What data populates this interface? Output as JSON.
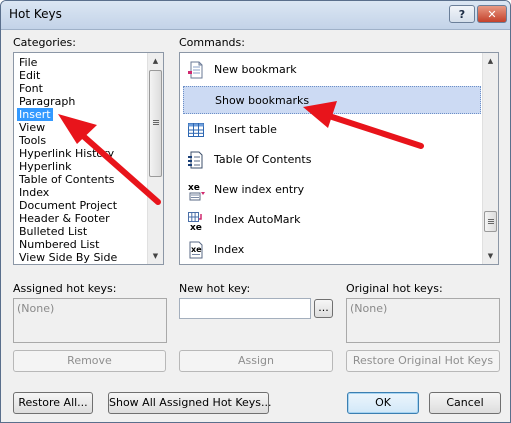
{
  "window": {
    "title": "Hot Keys"
  },
  "titlebar": {
    "help_label": "?",
    "close_label": "✕"
  },
  "categories": {
    "label": "Categories:",
    "items": [
      "File",
      "Edit",
      "Font",
      "Paragraph",
      "Insert",
      "View",
      "Tools",
      "Hyperlink History",
      "Hyperlink",
      "Table of Contents",
      "Index",
      "Document Project",
      "Header & Footer",
      "Bulleted List",
      "Numbered List",
      "View Side By Side"
    ],
    "selected": "Insert"
  },
  "commands": {
    "label": "Commands:",
    "items": [
      {
        "label": "New bookmark",
        "icon": "new-bookmark-icon"
      },
      {
        "label": "Show bookmarks",
        "icon": "",
        "selected": true
      },
      {
        "label": "Insert table",
        "icon": "insert-table-icon"
      },
      {
        "label": "Table Of Contents",
        "icon": "table-of-contents-icon"
      },
      {
        "label": "New index entry",
        "icon": "new-index-entry-icon"
      },
      {
        "label": "Index AutoMark",
        "icon": "index-automark-icon"
      },
      {
        "label": "Index",
        "icon": "index-icon"
      }
    ]
  },
  "assigned": {
    "label": "Assigned hot keys:",
    "value": "(None)"
  },
  "new_hot_key": {
    "label": "New hot key:",
    "value": "",
    "browse_label": "..."
  },
  "original": {
    "label": "Original hot keys:",
    "value": "(None)"
  },
  "buttons": {
    "remove": "Remove",
    "assign": "Assign",
    "restore_original": "Restore Original Hot Keys",
    "restore_all": "Restore All...",
    "show_all": "Show All Assigned Hot Keys...",
    "ok": "OK",
    "cancel": "Cancel"
  },
  "colors": {
    "selection": "#3399ff",
    "annotation_arrow": "#e8141b"
  }
}
